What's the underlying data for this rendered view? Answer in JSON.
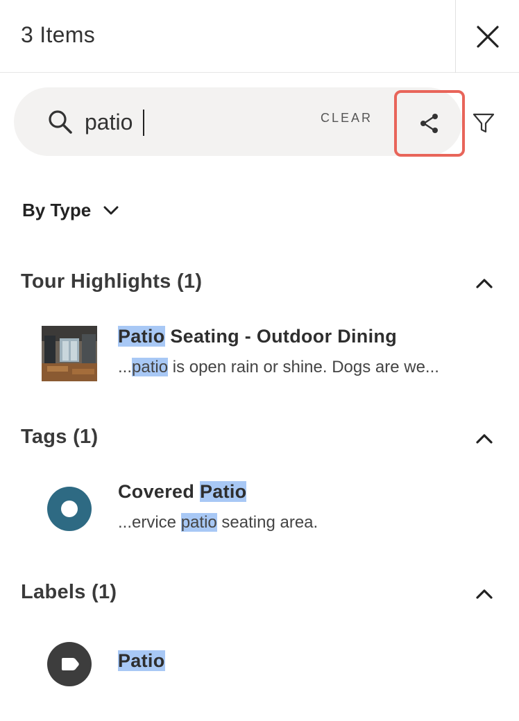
{
  "header": {
    "title": "3 Items",
    "close_icon": "close-icon"
  },
  "search": {
    "value": "patio",
    "placeholder": "",
    "clear_label": "CLEAR",
    "share_icon": "share-icon",
    "filter_icon": "filter-icon"
  },
  "group_by": {
    "label": "By Type"
  },
  "sections": [
    {
      "title": "Tour Highlights (1)",
      "results": [
        {
          "title_parts": [
            "Patio",
            " Seating - Outdoor Dining"
          ],
          "snippet_parts": [
            "...",
            "patio",
            " is open rain or shine. Dogs are we..."
          ]
        }
      ]
    },
    {
      "title": "Tags (1)",
      "results": [
        {
          "title_parts": [
            "Covered ",
            "Patio"
          ],
          "snippet_parts": [
            "...ervice ",
            "patio",
            " seating area."
          ]
        }
      ]
    },
    {
      "title": "Labels (1)",
      "results": [
        {
          "title_parts": [
            "Patio"
          ]
        }
      ]
    }
  ],
  "colors": {
    "highlight": "#a8c8f5",
    "tag_icon": "#2e6a83",
    "label_icon": "#3d3d3d",
    "share_outline": "#e8655a",
    "search_bg": "#f3f2f1"
  }
}
